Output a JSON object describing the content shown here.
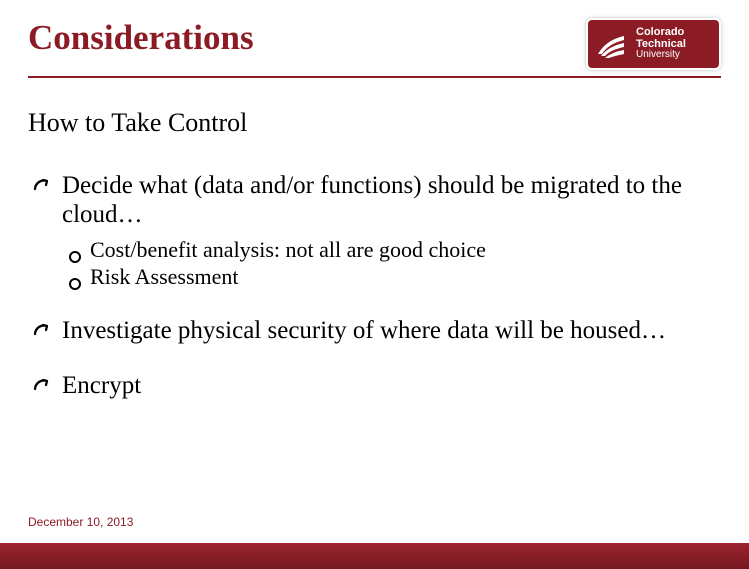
{
  "colors": {
    "brand": "#8b1c26"
  },
  "logo": {
    "line1": "Colorado",
    "line2": "Technical",
    "line3": "University"
  },
  "title": "Considerations",
  "subtitle": "How to Take Control",
  "bullets": [
    {
      "text": "Decide what (data and/or functions) should be migrated to the cloud…",
      "children": [
        "Cost/benefit analysis: not all are good choice",
        "Risk Assessment"
      ]
    },
    {
      "text": "Investigate physical security of where data will be housed…",
      "children": []
    },
    {
      "text": "Encrypt",
      "children": []
    }
  ],
  "footer_date": "December 10, 2013"
}
